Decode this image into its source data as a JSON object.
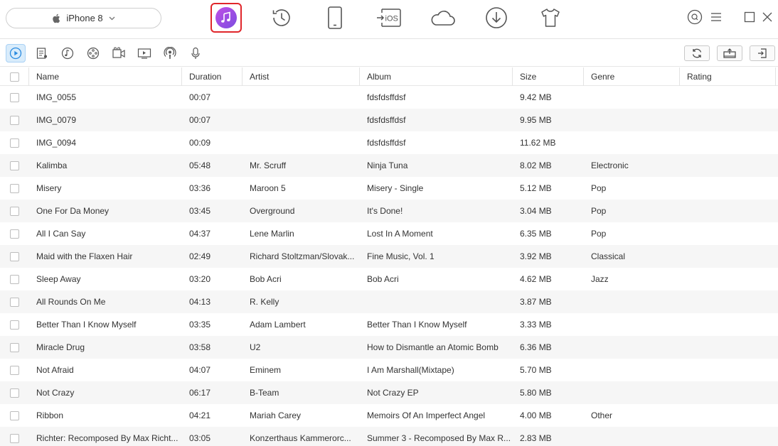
{
  "device": {
    "name": "iPhone 8"
  },
  "nav": [
    {
      "name": "music-manager-icon"
    },
    {
      "name": "history-icon"
    },
    {
      "name": "device-icon"
    },
    {
      "name": "ios-mover-icon"
    },
    {
      "name": "icloud-icon"
    },
    {
      "name": "download-icon"
    },
    {
      "name": "toolkit-shirt-icon"
    }
  ],
  "window_controls": [
    "search-icon",
    "menu-icon",
    "maximize-icon",
    "close-icon"
  ],
  "categories": [
    {
      "name": "music-category-icon",
      "active": true
    },
    {
      "name": "playlists-category-icon",
      "active": false
    },
    {
      "name": "ringtones-category-icon",
      "active": false
    },
    {
      "name": "albums-category-icon",
      "active": false
    },
    {
      "name": "videos-category-icon",
      "active": false
    },
    {
      "name": "tv-shows-category-icon",
      "active": false
    },
    {
      "name": "podcasts-category-icon",
      "active": false
    },
    {
      "name": "voice-memos-category-icon",
      "active": false
    }
  ],
  "actions": [
    "refresh-icon",
    "export-to-computer-icon",
    "import-icon"
  ],
  "table": {
    "headers": {
      "name": "Name",
      "duration": "Duration",
      "artist": "Artist",
      "album": "Album",
      "size": "Size",
      "genre": "Genre",
      "rating": "Rating"
    },
    "rows": [
      {
        "name": "IMG_0055",
        "duration": "00:07",
        "artist": "",
        "album": "fdsfdsffdsf",
        "size": "9.42 MB",
        "genre": "",
        "rating": ""
      },
      {
        "name": "IMG_0079",
        "duration": "00:07",
        "artist": "",
        "album": "fdsfdsffdsf",
        "size": "9.95 MB",
        "genre": "",
        "rating": ""
      },
      {
        "name": "IMG_0094",
        "duration": "00:09",
        "artist": "",
        "album": "fdsfdsffdsf",
        "size": "11.62 MB",
        "genre": "",
        "rating": ""
      },
      {
        "name": "Kalimba",
        "duration": "05:48",
        "artist": "Mr. Scruff",
        "album": "Ninja Tuna",
        "size": "8.02 MB",
        "genre": "Electronic",
        "rating": ""
      },
      {
        "name": "Misery",
        "duration": "03:36",
        "artist": "Maroon 5",
        "album": "Misery - Single",
        "size": "5.12 MB",
        "genre": "Pop",
        "rating": ""
      },
      {
        "name": "One For Da Money",
        "duration": "03:45",
        "artist": "Overground",
        "album": "It's Done!",
        "size": "3.04 MB",
        "genre": "Pop",
        "rating": ""
      },
      {
        "name": "All I Can Say",
        "duration": "04:37",
        "artist": "Lene Marlin",
        "album": "Lost In A Moment",
        "size": "6.35 MB",
        "genre": "Pop",
        "rating": ""
      },
      {
        "name": "Maid with the Flaxen Hair",
        "duration": "02:49",
        "artist": "Richard Stoltzman/Slovak...",
        "album": "Fine Music, Vol. 1",
        "size": "3.92 MB",
        "genre": "Classical",
        "rating": ""
      },
      {
        "name": "Sleep Away",
        "duration": "03:20",
        "artist": "Bob Acri",
        "album": "Bob Acri",
        "size": "4.62 MB",
        "genre": "Jazz",
        "rating": ""
      },
      {
        "name": "All Rounds On Me",
        "duration": "04:13",
        "artist": "R. Kelly",
        "album": "",
        "size": "3.87 MB",
        "genre": "",
        "rating": ""
      },
      {
        "name": "Better Than I Know Myself",
        "duration": "03:35",
        "artist": "Adam Lambert",
        "album": "Better Than I Know Myself",
        "size": "3.33 MB",
        "genre": "",
        "rating": ""
      },
      {
        "name": "Miracle Drug",
        "duration": "03:58",
        "artist": "U2",
        "album": "How to Dismantle an Atomic Bomb",
        "size": "6.36 MB",
        "genre": "",
        "rating": ""
      },
      {
        "name": "Not Afraid",
        "duration": "04:07",
        "artist": "Eminem",
        "album": "I Am Marshall(Mixtape)",
        "size": "5.70 MB",
        "genre": "",
        "rating": ""
      },
      {
        "name": "Not Crazy",
        "duration": "06:17",
        "artist": "B-Team",
        "album": "Not Crazy EP",
        "size": "5.80 MB",
        "genre": "",
        "rating": ""
      },
      {
        "name": "Ribbon",
        "duration": "04:21",
        "artist": "Mariah Carey",
        "album": "Memoirs Of An Imperfect Angel",
        "size": "4.00 MB",
        "genre": "Other",
        "rating": ""
      },
      {
        "name": "Richter: Recomposed By Max Richt...",
        "duration": "03:05",
        "artist": "Konzerthaus Kammerorc...",
        "album": "Summer 3 - Recomposed By Max R...",
        "size": "2.83 MB",
        "genre": "",
        "rating": ""
      }
    ]
  },
  "colors": {
    "accent_purple": "#a052e0",
    "active_outline": "#e0262b",
    "selected_category": "#d9ecfb"
  }
}
